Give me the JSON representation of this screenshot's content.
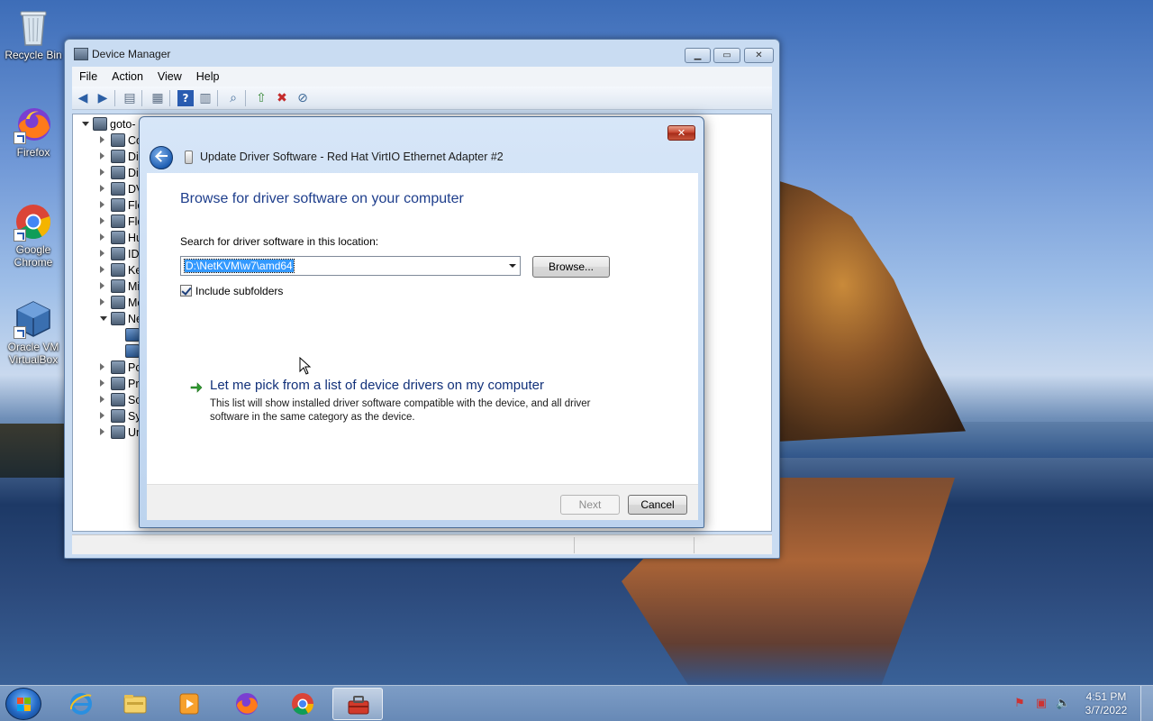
{
  "desktop": {
    "icons": [
      {
        "label": "Recycle Bin"
      },
      {
        "label": "Firefox"
      },
      {
        "label": "Google Chrome"
      },
      {
        "label": "Oracle VM VirtualBox"
      }
    ]
  },
  "device_manager": {
    "title": "Device Manager",
    "menu": [
      "File",
      "Action",
      "View",
      "Help"
    ],
    "tree": {
      "root": "goto-",
      "items": [
        "Co",
        "Di",
        "Di",
        "DV",
        "Flo",
        "Flo",
        "Hu",
        "ID",
        "Ke",
        "Mi",
        "Mo",
        "Ne",
        "",
        "",
        "Po",
        "Pr",
        "So",
        "Sy",
        "Un"
      ]
    }
  },
  "dialog": {
    "title": "Update Driver Software - Red Hat VirtIO Ethernet Adapter #2",
    "heading": "Browse for driver software on your computer",
    "location_label": "Search for driver software in this location:",
    "path_value": "D:\\NetKVM\\w7\\amd64",
    "browse_label": "Browse...",
    "include_subfolders_label": "Include subfolders",
    "include_subfolders_checked": true,
    "pick_title": "Let me pick from a list of device drivers on my computer",
    "pick_description": "This list will show installed driver software compatible with the device, and all driver software in the same category as the device.",
    "next_label": "Next",
    "cancel_label": "Cancel",
    "close_label": "✕"
  },
  "taskbar": {
    "apps": [
      "Internet Explorer",
      "Windows Explorer",
      "Windows Media Player",
      "Firefox",
      "Google Chrome",
      "Device Manager"
    ],
    "clock_time": "4:51 PM",
    "clock_date": "3/7/2022"
  },
  "colors": {
    "dialog_heading": "#1e3e8c",
    "selection": "#3399ff",
    "close_button": "#c5402a"
  }
}
